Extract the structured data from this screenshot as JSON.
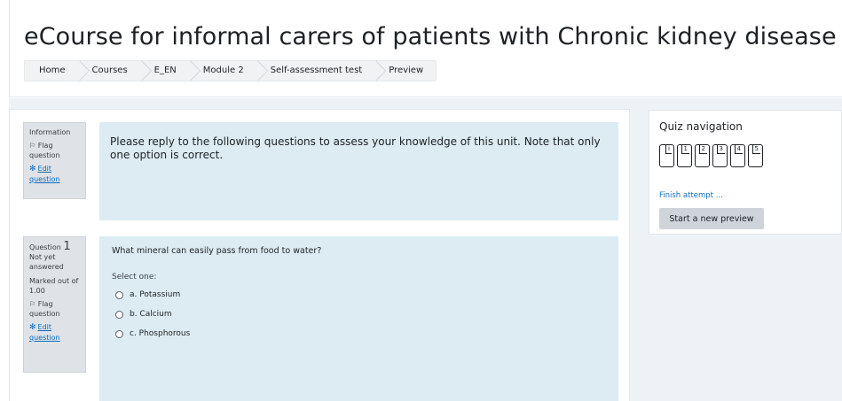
{
  "page": {
    "title": "eCourse for informal carers of patients with Chronic kidney disease"
  },
  "breadcrumb": [
    "Home",
    "Courses",
    "E_EN",
    "Module 2",
    "Self-assessment test",
    "Preview"
  ],
  "info_block": {
    "label": "Information",
    "flag_label": "Flag question",
    "edit_label": "Edit question",
    "text": "Please reply to the following questions to assess your knowledge of this unit. Note that only one option is correct."
  },
  "question1": {
    "label": "Question",
    "number": "1",
    "state": "Not yet answered",
    "marked": "Marked out of 1.00",
    "flag_label": "Flag question",
    "edit_label": "Edit question",
    "text": "What mineral can easily pass from food to water?",
    "prompt": "Select one:",
    "options": [
      "a. Potassium",
      "b. Calcium",
      "c. Phosphorous"
    ]
  },
  "quiz_nav": {
    "title": "Quiz navigation",
    "buttons": [
      "i",
      "1",
      "2",
      "3",
      "4",
      "5"
    ],
    "finish_link": "Finish attempt ...",
    "new_preview_label": "Start a new preview"
  },
  "colors": {
    "formulation_bg": "#dcecf2",
    "info_bg": "#dfe2e6",
    "link": "#0f6cbf"
  },
  "icons": {
    "flag": "flag-icon",
    "edit": "gear-icon"
  }
}
